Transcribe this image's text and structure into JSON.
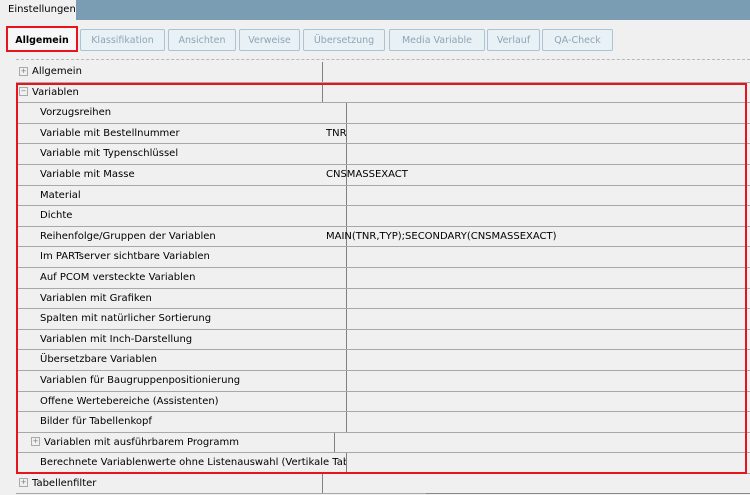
{
  "window_tab": "Einstellungen",
  "tabs": [
    {
      "label": "Allgemein",
      "active": true
    },
    {
      "label": "Klassifikation"
    },
    {
      "label": "Ansichten"
    },
    {
      "label": "Verweise"
    },
    {
      "label": "Übersetzung"
    },
    {
      "label": "Media Variable"
    },
    {
      "label": "Verlauf"
    },
    {
      "label": "QA-Check"
    }
  ],
  "tree": {
    "allgemein": "Allgemein",
    "variablen": "Variablen",
    "children": [
      {
        "label": "Vorzugsreihen",
        "value": ""
      },
      {
        "label": "Variable mit Bestellnummer",
        "value": "TNR"
      },
      {
        "label": "Variable mit Typenschlüssel",
        "value": ""
      },
      {
        "label": "Variable mit Masse",
        "value": "CNSMASSEXACT"
      },
      {
        "label": "Material",
        "value": ""
      },
      {
        "label": "Dichte",
        "value": ""
      },
      {
        "label": "Reihenfolge/Gruppen der Variablen",
        "value": "MAIN(TNR,TYP);SECONDARY(CNSMASSEXACT)"
      },
      {
        "label": "Im PARTserver sichtbare Variablen",
        "value": ""
      },
      {
        "label": "Auf PCOM versteckte Variablen",
        "value": ""
      },
      {
        "label": "Variablen mit Grafiken",
        "value": ""
      },
      {
        "label": "Spalten mit natürlicher Sortierung",
        "value": ""
      },
      {
        "label": "Variablen mit Inch-Darstellung",
        "value": ""
      },
      {
        "label": "Übersetzbare Variablen",
        "value": ""
      },
      {
        "label": "Variablen für Baugruppenpositionierung",
        "value": ""
      },
      {
        "label": "Offene Wertebereiche (Assistenten)",
        "value": ""
      },
      {
        "label": "Bilder für Tabellenkopf",
        "value": ""
      },
      {
        "label": "Variablen mit ausführbarem Programm",
        "value": "",
        "expandable": true
      },
      {
        "label": "Berechnete Variablenwerte ohne Listenauswahl (Vertikale Tabelle)",
        "value": ""
      }
    ],
    "tabellenfilter": "Tabellenfilter"
  }
}
